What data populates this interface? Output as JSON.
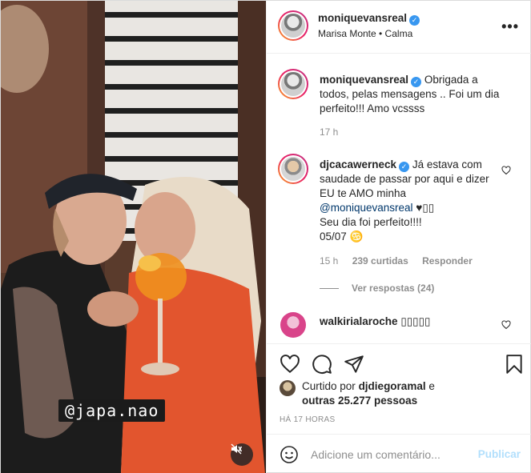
{
  "header": {
    "username": "moniquevansreal",
    "audio": "Marisa Monte • Calma",
    "more_icon": "more-options-icon"
  },
  "media": {
    "tag_text": "@japa.nao",
    "mute_icon": "speaker-muted-icon"
  },
  "comments": [
    {
      "username": "moniquevansreal",
      "verified": true,
      "text": "Obrigada a todos, pelas mensagens .. Foi um dia perfeito!!! Amo vcssss",
      "time": "17 h"
    },
    {
      "username": "djcacawerneck",
      "verified": true,
      "text_line1": "Já estava com saudade de passar por aqui e dizer EU te AMO minha",
      "mention": "@moniquevansreal",
      "text_line2": "♥▯▯",
      "text_line3": "Seu dia foi perfeito!!!!",
      "text_line4": "05/07 ♋",
      "time": "15 h",
      "likes": "239 curtidas",
      "reply": "Responder",
      "view_replies": "Ver respostas (24)"
    },
    {
      "username": "walkirialaroche",
      "text": "▯▯▯▯▯"
    }
  ],
  "actions": {
    "liked_prefix": "Curtido por",
    "liked_user": "djdiegoramal",
    "liked_conj": "e",
    "liked_others": "outras 25.277 pessoas",
    "timestamp": "HÁ 17 HORAS"
  },
  "add_comment": {
    "placeholder": "Adicione um comentário...",
    "publish": "Publicar"
  },
  "colors": {
    "link": "#00376b",
    "verified": "#3897f0",
    "muted_text": "#8e8e8e",
    "publish_disabled": "#b2dffc"
  }
}
